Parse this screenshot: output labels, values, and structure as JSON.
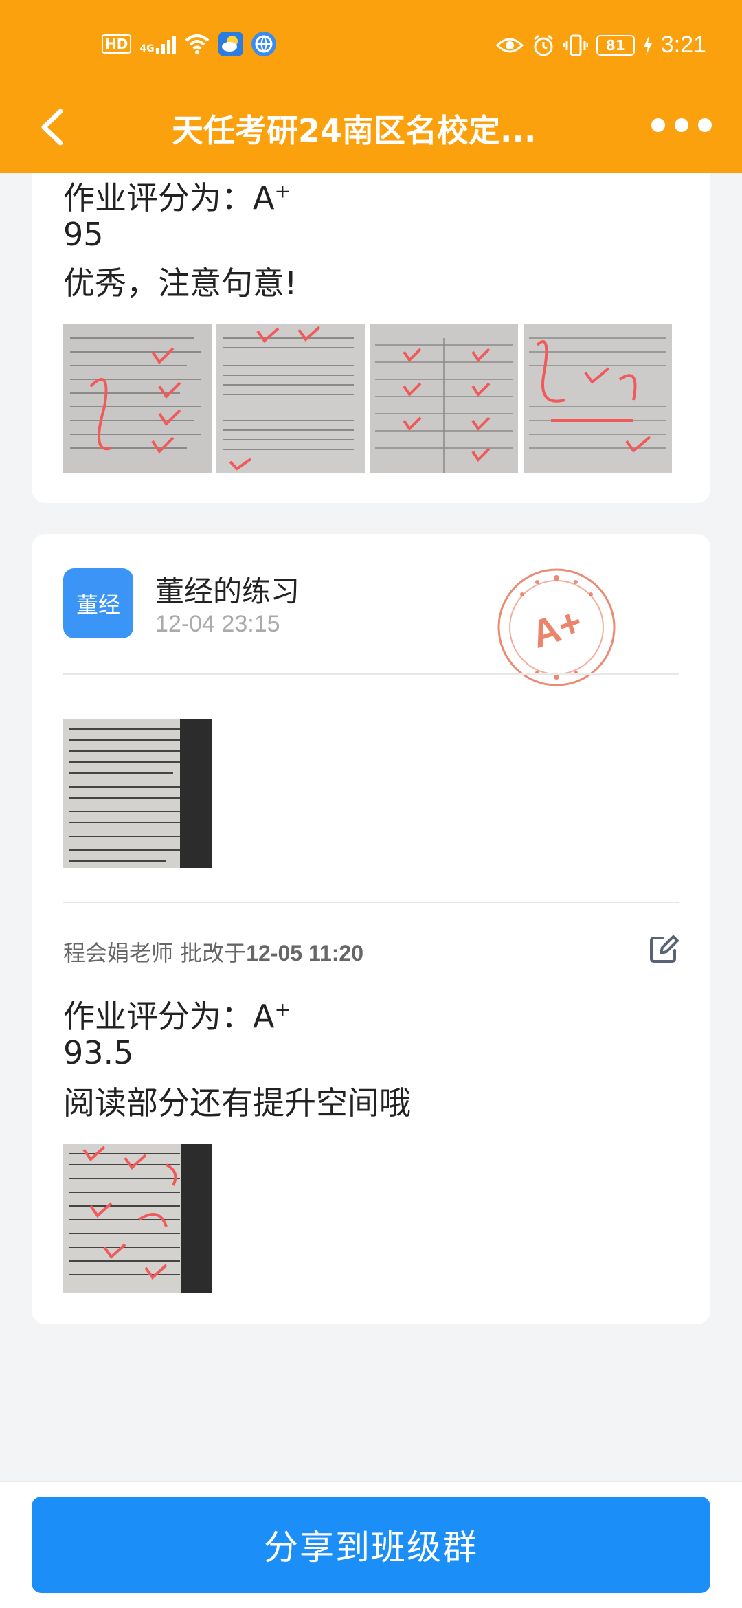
{
  "status_bar": {
    "network": "HD",
    "signal_label": "4G",
    "battery": "81",
    "time": "3:21"
  },
  "header": {
    "title": "天任考研24南区名校定..."
  },
  "card1": {
    "grade_prefix": "作业评分为：A",
    "grade_sup": "+",
    "score": "95",
    "comment": "优秀，注意句意!"
  },
  "card2": {
    "avatar_label": "董经",
    "author": "董经的练习",
    "submitted_at": "12-04 23:15",
    "stamp_label": "A+",
    "teacher": "程会娟老师",
    "graded_prefix": "批改于",
    "graded_at": "12-05 11:20",
    "grade_prefix": "作业评分为：A",
    "grade_sup": "+",
    "score": "93.5",
    "comment": "阅读部分还有提升空间哦"
  },
  "bottom": {
    "share_label": "分享到班级群"
  },
  "colors": {
    "header": "#fba10e",
    "accent": "#1b8ff7",
    "avatar": "#3b95f6",
    "stamp": "#e9775b"
  }
}
